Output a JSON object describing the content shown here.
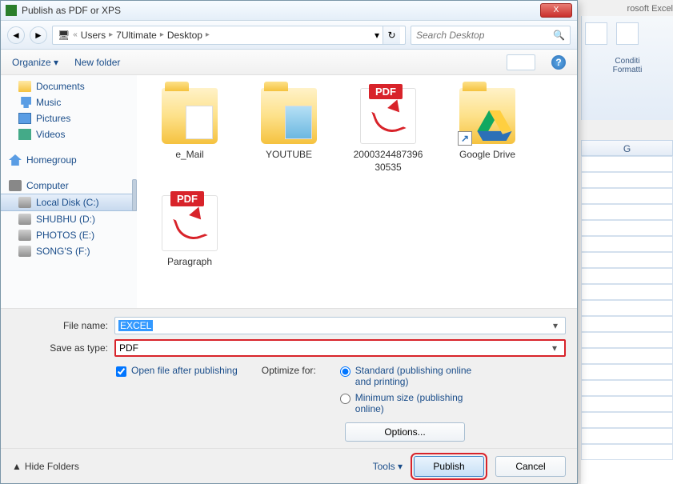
{
  "window": {
    "title": "Publish as PDF or XPS",
    "close": "X"
  },
  "nav": {
    "back": "◄",
    "forward": "►",
    "crumbs": [
      "Users",
      "7Ultimate",
      "Desktop"
    ],
    "sep": "▸",
    "dropdown": "▾",
    "refresh": "↻",
    "search_placeholder": "Search Desktop"
  },
  "toolbar": {
    "organize": "Organize ▾",
    "newfolder": "New folder",
    "help": "?"
  },
  "sidebar": {
    "items": [
      {
        "label": "Documents",
        "cls": "i-folder"
      },
      {
        "label": "Music",
        "cls": "i-music"
      },
      {
        "label": "Pictures",
        "cls": "i-pic"
      },
      {
        "label": "Videos",
        "cls": "i-vid"
      }
    ],
    "homegroup": "Homegroup",
    "computer": "Computer",
    "drives": [
      {
        "label": "Local Disk (C:)",
        "selected": true
      },
      {
        "label": "SHUBHU (D:)"
      },
      {
        "label": "PHOTOS (E:)"
      },
      {
        "label": "SONG'S (F:)"
      }
    ]
  },
  "files": {
    "e_mail": "e_Mail",
    "youtube": "YOUTUBE",
    "pdfnum": "2000324487396\n30535",
    "gdrive": "Google Drive",
    "paragraph": "Paragraph",
    "pdf_badge": "PDF",
    "shortcut": "↗"
  },
  "form": {
    "filename_label": "File name:",
    "filename_value": "EXCEL",
    "savetype_label": "Save as type:",
    "savetype_value": "PDF",
    "arrow": "▾"
  },
  "options": {
    "openafter": "Open file after publishing",
    "optimize_label": "Optimize for:",
    "standard": "Standard (publishing online and printing)",
    "minimum": "Minimum size (publishing online)",
    "options_btn": "Options..."
  },
  "footer": {
    "hide": "Hide Folders",
    "hide_arrow": "▲",
    "tools": "Tools   ▾",
    "publish": "Publish",
    "cancel": "Cancel"
  },
  "excel": {
    "app": "rosoft Excel",
    "cond": "Conditi\nFormatti",
    "col": "G"
  }
}
